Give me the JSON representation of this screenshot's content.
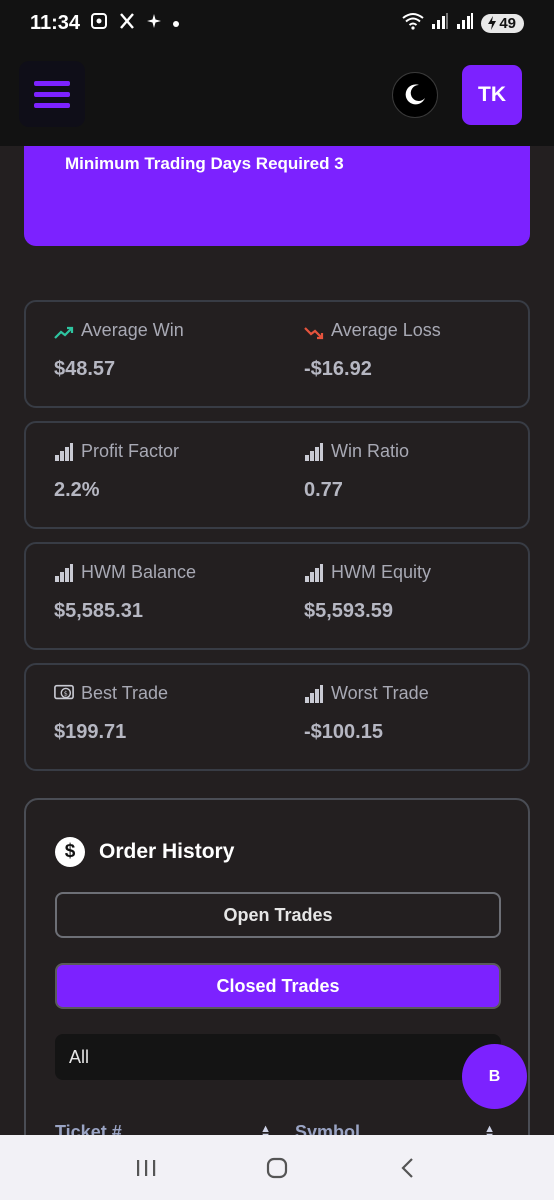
{
  "status_bar": {
    "time": "11:34",
    "battery": "49",
    "left_icons": [
      "screenshot-icon",
      "x-icon",
      "sparkle-icon",
      "dot-icon"
    ],
    "right_icons": [
      "wifi-icon",
      "signal-icon",
      "signal-icon",
      "battery-icon"
    ]
  },
  "header": {
    "avatar_initials": "TK",
    "menu_icon": "hamburger-icon",
    "theme_icon": "moon-icon"
  },
  "rules": {
    "min_days_text": "Minimum Trading Days Required 3"
  },
  "stats": [
    {
      "left": {
        "label": "Average Win",
        "value": "$48.57",
        "icon": "trending-up-icon"
      },
      "right": {
        "label": "Average Loss",
        "value": "-$16.92",
        "icon": "trending-down-icon"
      }
    },
    {
      "left": {
        "label": "Profit Factor",
        "value": "2.2%",
        "icon": "bar-chart-icon"
      },
      "right": {
        "label": "Win Ratio",
        "value": "0.77",
        "icon": "bar-chart-icon"
      }
    },
    {
      "left": {
        "label": "HWM Balance",
        "value": "$5,585.31",
        "icon": "bar-chart-icon"
      },
      "right": {
        "label": "HWM Equity",
        "value": "$5,593.59",
        "icon": "bar-chart-icon"
      }
    },
    {
      "left": {
        "label": "Best Trade",
        "value": "$199.71",
        "icon": "money-icon"
      },
      "right": {
        "label": "Worst Trade",
        "value": "-$100.15",
        "icon": "bar-chart-icon"
      }
    }
  ],
  "order_history": {
    "title": "Order History",
    "icon": "dollar-icon",
    "open_tab": "Open Trades",
    "closed_tab": "Closed Trades",
    "filter_value": "All",
    "columns": [
      "Ticket #",
      "Symbol"
    ]
  },
  "fab_label": "B",
  "colors": {
    "accent": "#7c22ff",
    "background": "#231f20",
    "up": "#2ec4a0",
    "down": "#e5533d"
  }
}
